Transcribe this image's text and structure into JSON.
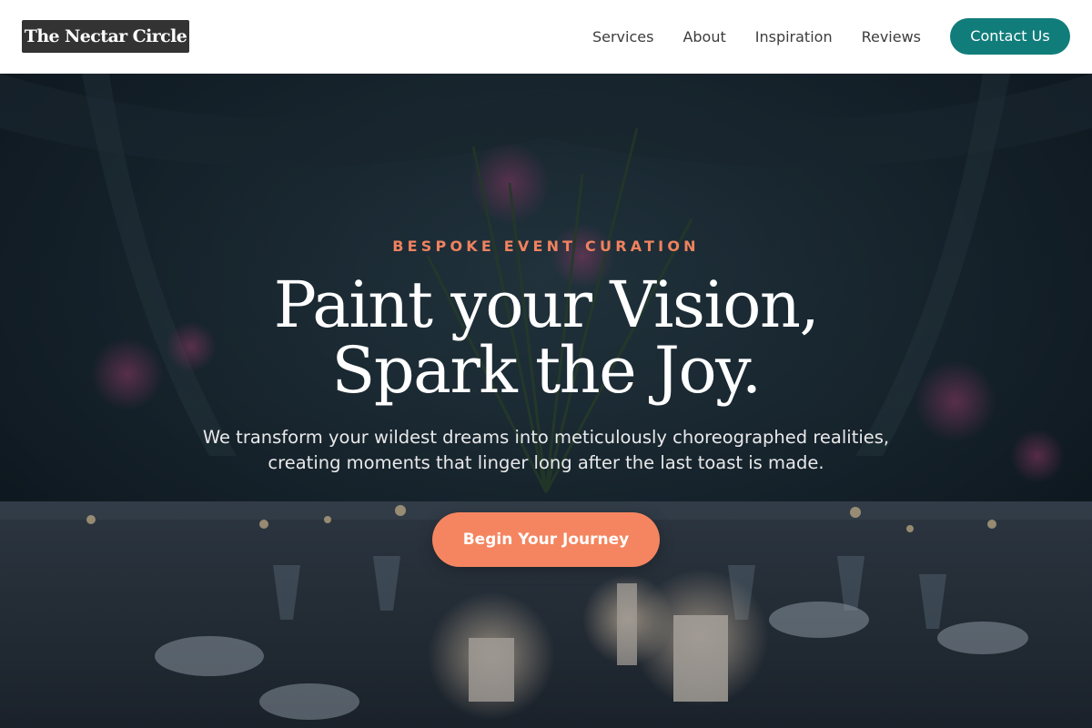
{
  "brand": {
    "name": "The Nectar Circle"
  },
  "nav": {
    "links": [
      "Services",
      "About",
      "Inspiration",
      "Reviews"
    ],
    "contact_label": "Contact Us"
  },
  "hero": {
    "eyebrow": "BESPOKE EVENT CURATION",
    "headline": "Paint your Vision, Spark the Joy.",
    "subheadline": "We transform your wildest dreams into meticulously choreographed realities, creating moments that linger long after the last toast is made.",
    "cta_label": "Begin Your Journey",
    "background_image": "evening banquet table with candles, glassware and floral centerpiece"
  },
  "colors": {
    "logo_bg": "#333333",
    "nav_text": "#3d3d3d",
    "contact_button": "#107d7b",
    "eyebrow": "#f0825f",
    "cta_button": "#f58560",
    "headline": "#ffffff"
  },
  "icons": []
}
